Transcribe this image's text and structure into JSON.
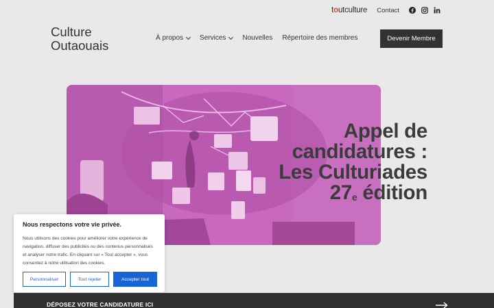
{
  "topbar": {
    "logo_prefix": "t",
    "logo_dot": "o",
    "logo_rest": "utculture",
    "contact": "Contact",
    "social_icons": [
      "facebook-icon",
      "instagram-icon",
      "linkedin-icon"
    ]
  },
  "brand": {
    "line1": "Culture",
    "line2": "Outaouais"
  },
  "nav": {
    "items": [
      {
        "label": "À propos",
        "has_dropdown": true
      },
      {
        "label": "Services",
        "has_dropdown": true
      },
      {
        "label": "Nouvelles",
        "has_dropdown": false
      },
      {
        "label": "Répertoire des membres",
        "has_dropdown": false
      }
    ],
    "cta": "Devenir Membre"
  },
  "hero": {
    "line1": "Appel de",
    "line2": "candidatures :",
    "line3": "Les Culturiades",
    "line4_num": "27",
    "line4_sup": "e",
    "line4_rest": " édition",
    "tint": "#c868bf"
  },
  "cookie": {
    "title": "Nous respectons votre vie privée.",
    "body": "Nous utilisons des cookies pour améliorer votre expérience de navigation, diffuser des publicités ou des contenus personnalisés et analyser notre trafic. En cliquant sur « Tout accepter », vous consentez à notre utilisation des cookies.",
    "customize": "Personnaliser",
    "reject": "Tout rejeter",
    "accept": "Accepter tout"
  },
  "banner": {
    "label": "DÉPOSEZ VOTRE CANDIDATURE ICI"
  },
  "colors": {
    "accent_blue": "#1863d8",
    "dark": "#323232",
    "background": "#e9e9ea"
  }
}
